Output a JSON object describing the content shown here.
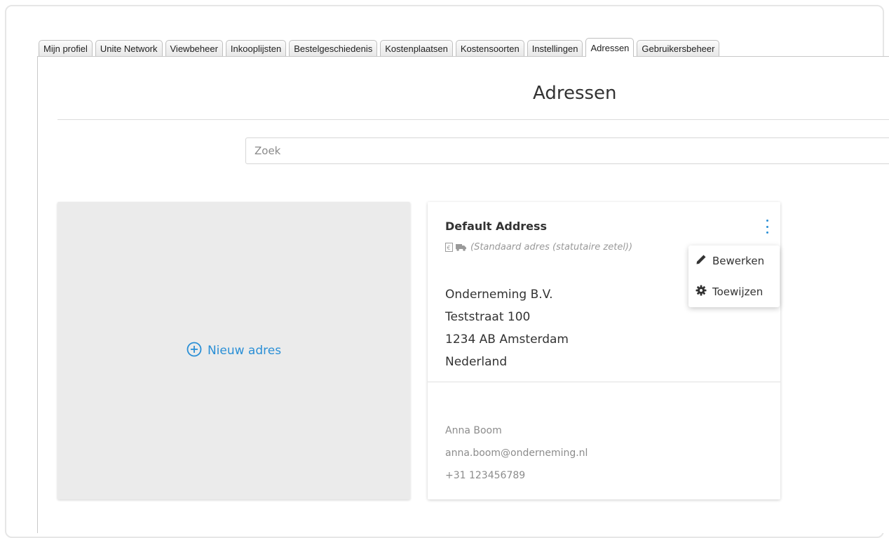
{
  "tabs": [
    {
      "label": "Mijn profiel",
      "active": false
    },
    {
      "label": "Unite Network",
      "active": false
    },
    {
      "label": "Viewbeheer",
      "active": false
    },
    {
      "label": "Inkooplijsten",
      "active": false
    },
    {
      "label": "Bestelgeschiedenis",
      "active": false
    },
    {
      "label": "Kostenplaatsen",
      "active": false
    },
    {
      "label": "Kostensoorten",
      "active": false
    },
    {
      "label": "Instellingen",
      "active": false
    },
    {
      "label": "Adressen",
      "active": true
    },
    {
      "label": "Gebruikersbeheer",
      "active": false
    }
  ],
  "page": {
    "title": "Adressen"
  },
  "search": {
    "placeholder": "Zoek",
    "value": ""
  },
  "new_address": {
    "label": "Nieuw adres",
    "icon": "plus-circle-icon"
  },
  "address_card": {
    "name": "Default Address",
    "type_icons": [
      "invoice-icon",
      "truck-icon"
    ],
    "type_label": "(Standaard adres (statutaire zetel))",
    "lines": [
      "Onderneming B.V.",
      "Teststraat 100",
      "1234 AB Amsterdam",
      "Nederland"
    ],
    "contact": {
      "name": "Anna Boom",
      "email": "anna.boom@onderneming.nl",
      "phone": "+31 123456789"
    }
  },
  "context_menu": {
    "items": [
      {
        "label": "Bewerken",
        "icon": "pencil-icon"
      },
      {
        "label": "Toewijzen",
        "icon": "gear-icon"
      }
    ]
  },
  "colors": {
    "accent": "#2a8fd6",
    "new_card_bg": "#ebebeb",
    "muted_text": "#8c8c8c"
  }
}
